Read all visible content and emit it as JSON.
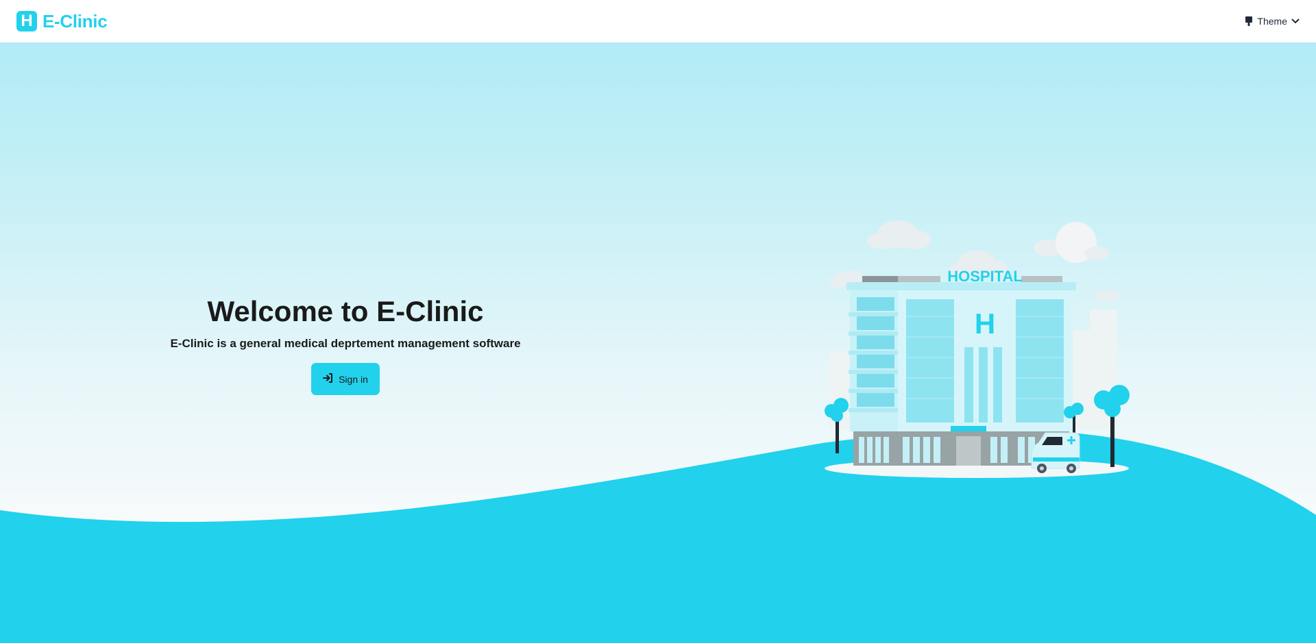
{
  "header": {
    "brand_letter": "H",
    "brand_name": "E-Clinic",
    "theme_label": "Theme"
  },
  "hero": {
    "title": "Welcome to E-Clinic",
    "subtitle": "E-Clinic is a general medical deprtement management software",
    "signin_label": "Sign in"
  },
  "illustration": {
    "sign_text": "HOSPITAL",
    "building_letter": "H"
  },
  "colors": {
    "accent": "#22d1ec",
    "text": "#1a1a1a",
    "sky_top": "#b2ebf6"
  },
  "icons": [
    "hospital-logo-icon",
    "theme-palette-icon",
    "chevron-down-icon",
    "sign-in-icon"
  ]
}
